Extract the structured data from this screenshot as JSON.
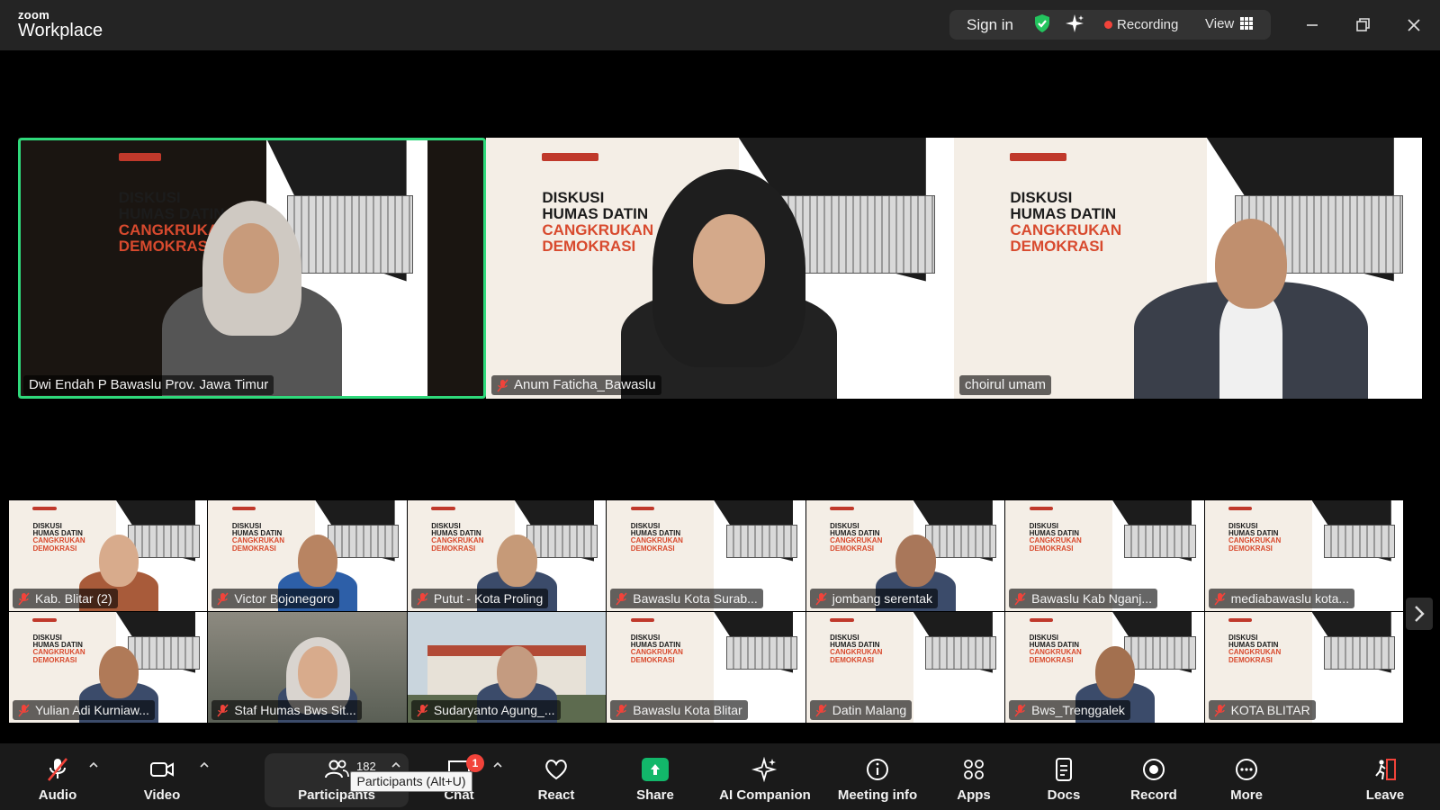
{
  "app": {
    "brand_small": "zoom",
    "brand_big": "Workplace"
  },
  "titlebar": {
    "sign_in": "Sign in",
    "recording": "Recording",
    "view": "View"
  },
  "speakers": [
    {
      "name": "Dwi Endah P Bawaslu Prov. Jawa Timur",
      "active": true,
      "muted": false
    },
    {
      "name": "Anum Faticha_Bawaslu",
      "active": false,
      "muted": true
    },
    {
      "name": "choirul umam",
      "active": false,
      "muted": false
    }
  ],
  "poster": {
    "line1": "DISKUSI",
    "line2": "HUMAS DATIN",
    "line3": "CANGKRUKAN",
    "line4": "DEMOKRASI"
  },
  "gallery": [
    {
      "name": "Kab. Blitar (2)",
      "muted": true
    },
    {
      "name": "Victor Bojonegoro",
      "muted": true
    },
    {
      "name": "Putut - Kota Proling",
      "muted": true
    },
    {
      "name": "Bawaslu Kota Surab...",
      "muted": true
    },
    {
      "name": "jombang serentak",
      "muted": true
    },
    {
      "name": "Bawaslu Kab Nganj...",
      "muted": true
    },
    {
      "name": "mediabawaslu kota...",
      "muted": true
    },
    {
      "name": "Yulian Adi Kurniaw...",
      "muted": true
    },
    {
      "name": "Staf Humas Bws Sit...",
      "muted": true
    },
    {
      "name": "Sudaryanto Agung_...",
      "muted": true
    },
    {
      "name": "Bawaslu Kota Blitar",
      "muted": true
    },
    {
      "name": "Datin Malang",
      "muted": true
    },
    {
      "name": "Bws_Trenggalek",
      "muted": true
    },
    {
      "name": "KOTA BLITAR",
      "muted": true
    }
  ],
  "toolbar": {
    "audio": "Audio",
    "video": "Video",
    "participants": "Participants",
    "participants_count": "182",
    "chat": "Chat",
    "chat_badge": "1",
    "react": "React",
    "share": "Share",
    "ai_companion": "AI Companion",
    "meeting_info": "Meeting info",
    "apps": "Apps",
    "docs": "Docs",
    "record": "Record",
    "more": "More",
    "leave": "Leave"
  },
  "tooltip": {
    "text": "Participants (Alt+U)"
  },
  "colors": {
    "active_speaker": "#2fd97b",
    "recording": "#f2433a",
    "share": "#12b76a",
    "leave": "#f2433a"
  }
}
